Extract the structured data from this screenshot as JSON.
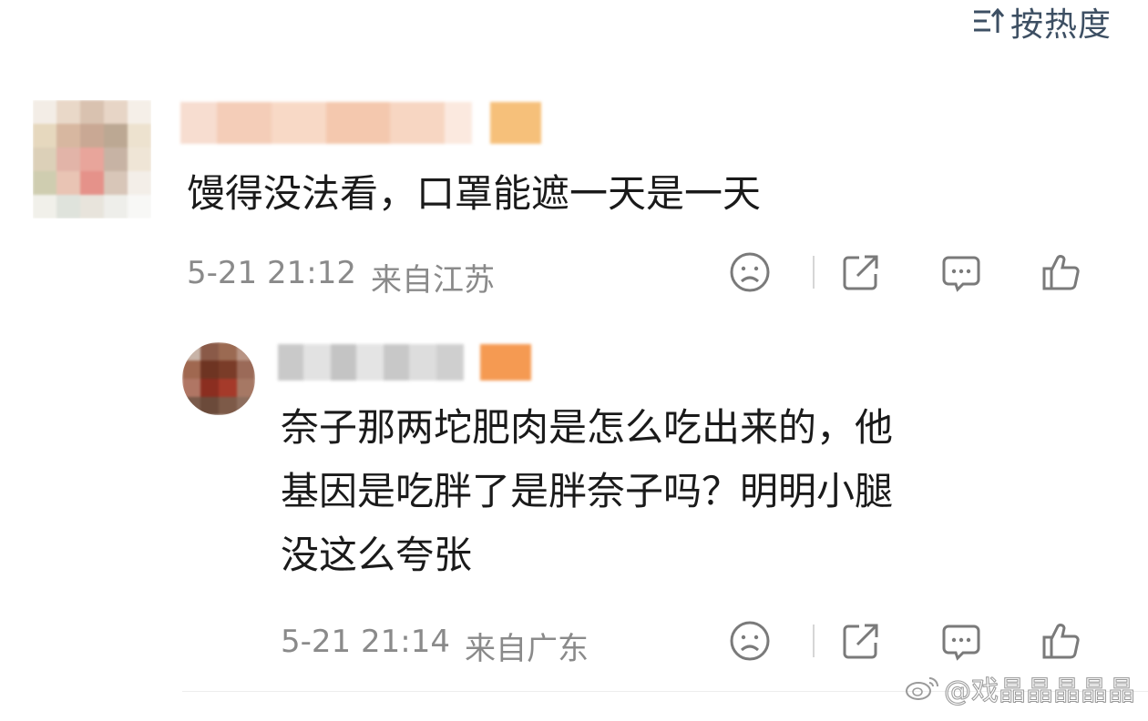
{
  "sort": {
    "label": "按热度",
    "icon": "sort-descending-icon"
  },
  "comments": [
    {
      "text": "馒得没法看，口罩能遮一天是一天",
      "date": "5-21 21:12",
      "location": "来自江苏"
    },
    {
      "text_lines": [
        "奈子那两坨肥肉是怎么吃出来的，他",
        "基因是吃胖了是胖奈子吗？明明小腿",
        "没这么夸张"
      ],
      "date": "5-21 21:14",
      "location": "来自广东"
    }
  ],
  "actions": [
    "dislike-face-icon",
    "share-icon",
    "comment-icon",
    "like-thumb-icon"
  ],
  "watermark": {
    "text": "@戏晶晶晶晶晶",
    "icon": "weibo-logo-icon"
  }
}
